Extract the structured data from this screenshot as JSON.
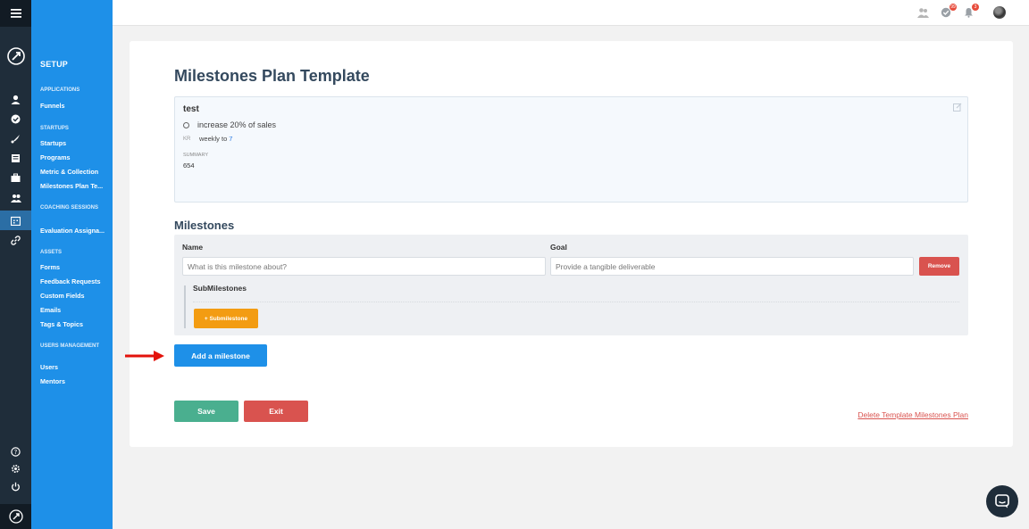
{
  "rail": {
    "icons": [
      "hamburger-icon",
      "rocket-logo-icon",
      "user-icon",
      "check-circle-icon",
      "rocket-icon",
      "document-icon",
      "briefcase-icon",
      "group-icon",
      "calendar-icon",
      "link-icon",
      "help-icon",
      "settings-icon",
      "power-icon",
      "rocket-footer-icon"
    ],
    "active_color": "#2b6ea5"
  },
  "menu": {
    "title": "SETUP",
    "sections": {
      "applications": "APPLICATIONS",
      "startups": "STARTUPS",
      "coaching": "COACHING SESSIONS",
      "assets": "ASSETS",
      "users": "USERS MANAGEMENT"
    },
    "items": {
      "funnels": "Funnels",
      "startups": "Startups",
      "programs": "Programs",
      "metric": "Metric & Collection",
      "milestones": "Milestones Plan Te...",
      "evaluation": "Evaluation Assigna...",
      "forms": "Forms",
      "feedback": "Feedback Requests",
      "custom_fields": "Custom Fields",
      "emails": "Emails",
      "tags": "Tags & Topics",
      "users": "Users",
      "mentors": "Mentors"
    }
  },
  "topbar": {
    "badges": {
      "tasks": "99",
      "notifications": "3"
    }
  },
  "page": {
    "title": "Milestones Plan Template",
    "info": {
      "name": "test",
      "objective": "increase 20% of sales",
      "kr_tag": "KR",
      "kr_text": "weekly to",
      "kr_value": "7",
      "summary_label": "SUMMARY",
      "summary_value": "654"
    },
    "milestones": {
      "title": "Milestones",
      "name_label": "Name",
      "goal_label": "Goal",
      "name_placeholder": "What is this milestone about?",
      "goal_placeholder": "Provide a tangible deliverable",
      "remove_label": "Remove",
      "submilestones_label": "SubMilestones",
      "add_sub_label": "+ Submilestone"
    },
    "add_milestone_label": "Add a milestone",
    "save_label": "Save",
    "exit_label": "Exit",
    "delete_label": "Delete Template Milestones Plan"
  },
  "colors": {
    "menu_blue": "#1e90e8",
    "rail_dark": "#1f2d3a",
    "save_green": "#4aaf8f",
    "danger_red": "#d9534f",
    "orange": "#f39c12"
  }
}
